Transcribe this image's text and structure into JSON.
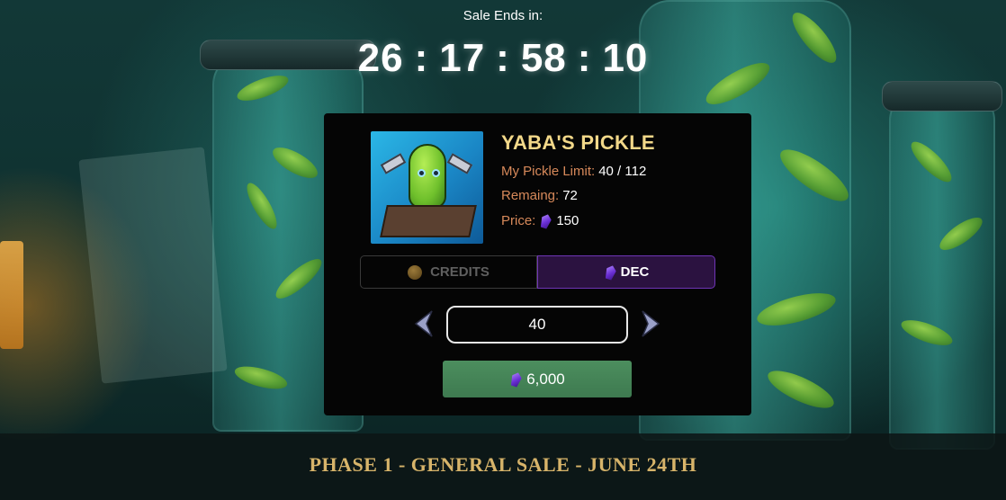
{
  "header": {
    "sale_label": "Sale Ends in:",
    "countdown": {
      "days": "26",
      "hours": "17",
      "minutes": "58",
      "seconds": "10",
      "separator": ":"
    }
  },
  "product": {
    "title": "YABA'S PICKLE",
    "limit_label": "My Pickle Limit:",
    "limit_value": "40 / 112",
    "remaining_label": "Remaing:",
    "remaining_value": "72",
    "price_label": "Price:",
    "price_value": "150",
    "price_icon": "dec-gem-icon"
  },
  "payment_tabs": {
    "credits_label": "CREDITS",
    "dec_label": "DEC",
    "selected": "DEC"
  },
  "quantity": {
    "value": "40"
  },
  "buy_button": {
    "label": "6,000",
    "icon": "dec-gem-icon"
  },
  "footer": {
    "phase_text": "PHASE 1 - GENERAL SALE - JUNE 24TH"
  },
  "colors": {
    "title": "#f2d889",
    "label": "#d7895a",
    "dec_tab_bg": "#2b1240",
    "dec_tab_border": "#6e35b5",
    "buy_button": "#4c8e5e",
    "phase_text": "#d7b46a"
  }
}
